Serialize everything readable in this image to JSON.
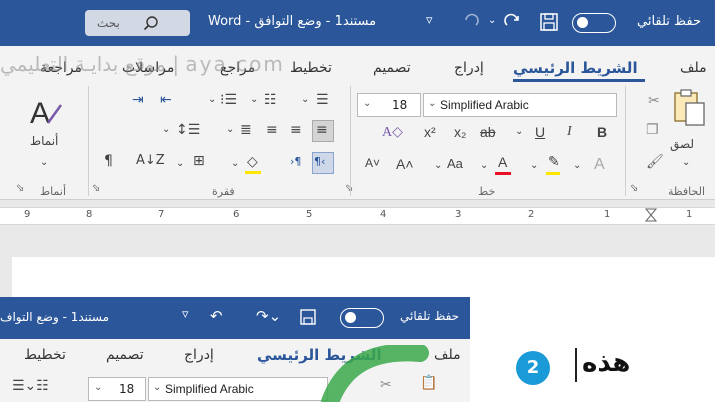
{
  "titlebar": {
    "autosave_label": "حفظ تلقائي",
    "doc_title": "مستند1 - وضع التوافق - Word",
    "search_label": "بحث"
  },
  "watermark": "موقع بدايـة التعليمي | aya.com",
  "tabs": [
    "ملف",
    "الشريط الرئيسي",
    "إدراج",
    "تصميم",
    "تخطيط",
    "مراجع",
    "مراسلات",
    "مراجعة"
  ],
  "ribbon": {
    "paste_label": "لصق",
    "font_name": "Simplified Arabic",
    "font_size": "18",
    "styles_label": "أنماط",
    "clipboard_group": "الحافظة",
    "font_group": "خط",
    "paragraph_group": "فقرة",
    "styles_group": "أنماط"
  },
  "ruler": [
    "1",
    "1",
    "2",
    "3",
    "4",
    "5",
    "6",
    "7",
    "8",
    "9"
  ],
  "zoom": {
    "autosave_label": "حفظ تلقائي",
    "doc_title": "مستند1 - وضع التواف",
    "tabs": [
      "ملف",
      "الشريط الرئيسي",
      "إدراج",
      "تصميم",
      "تخطيط"
    ],
    "font_name": "Simplified Arabic",
    "font_size": "18",
    "step": "2",
    "doc_text": "هذه"
  }
}
